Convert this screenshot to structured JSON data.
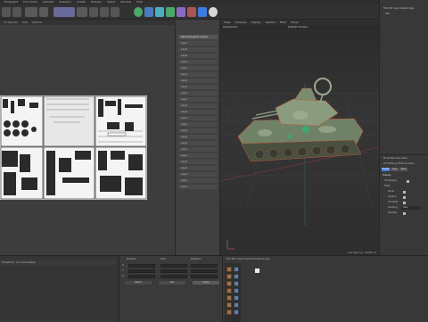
{
  "menubar": {
    "items": [
      "Bodypaint",
      "Document",
      "Animate",
      "Selection",
      "Create",
      "Modeler",
      "Select",
      "Window",
      "Help"
    ],
    "right": "Node Space"
  },
  "toolbar": {
    "icons": [
      "undo-icon",
      "redo-icon",
      "live-select-icon",
      "move-icon",
      "scale-icon",
      "rotate-icon",
      "render-icon",
      "cube-icon",
      "pen-icon",
      "subdivision-icon",
      "cloner-icon",
      "deformer-icon",
      "scene-icon",
      "camera-icon",
      "light-icon"
    ]
  },
  "uv_editor": {
    "menus": [
      "UV Spaces",
      "Edit",
      "Options"
    ]
  },
  "layers_panel": {
    "title": "Bake Bodypaint Layers",
    "rows": [
      "Layer",
      "Layer",
      "Layer",
      "Layer",
      "Layer",
      "Layer",
      "Layer",
      "Layer",
      "Layer",
      "Layer",
      "Layer",
      "Layer",
      "Layer",
      "Layer",
      "Layer",
      "Layer",
      "Layer",
      "Layer",
      "Layer",
      "Layer",
      "Layer",
      "Layer",
      "Layer",
      "Layer",
      "Layer",
      "Layer",
      "Layer",
      "Layer",
      "Layer",
      "Layer"
    ]
  },
  "viewport": {
    "menus": [
      "View",
      "Cameras",
      "Display",
      "Options",
      "Filter",
      "Panel"
    ],
    "camera": "Perspective",
    "title": "Default Camera",
    "grid_spacing": "Grid Spacing : 10000 cm"
  },
  "objects_panel": {
    "menus": [
      "File",
      "Edit",
      "View",
      "Objects",
      "Tags"
    ],
    "object": "ZSU"
  },
  "attributes": {
    "menus": [
      "Mode",
      "Edit",
      "User Data"
    ],
    "header": "UV Settings [Texture View]",
    "tabs": [
      "Display",
      "View",
      "Tools"
    ],
    "section": "Display",
    "fields": [
      {
        "label": "UV Display",
        "value": ""
      },
      {
        "label": "Filled",
        "value": ""
      },
      {
        "label": "Show",
        "value": ""
      },
      {
        "label": "Outline",
        "value": ""
      },
      {
        "label": "UV Mesh",
        "value": ""
      },
      {
        "label": "Shading",
        "value": "Grey"
      },
      {
        "label": "Flexible",
        "value": ""
      }
    ]
  },
  "bottom": {
    "tabs": [
      "Transform",
      "UV Coordinates"
    ],
    "coord_headers": [
      "Position",
      "Size",
      "Rotation"
    ],
    "coord_rows": [
      "X",
      "Y",
      "Z"
    ],
    "coord_buttons": [
      "Object",
      "Size",
      "Apply"
    ],
    "timeline_menus": [
      "File",
      "Edit",
      "View",
      "Frame",
      "Functions",
      "Key"
    ]
  },
  "colors": {
    "accent": "#3d7be0",
    "tank_green": "#7a9270",
    "texture_bg": "#e6e6e6"
  }
}
